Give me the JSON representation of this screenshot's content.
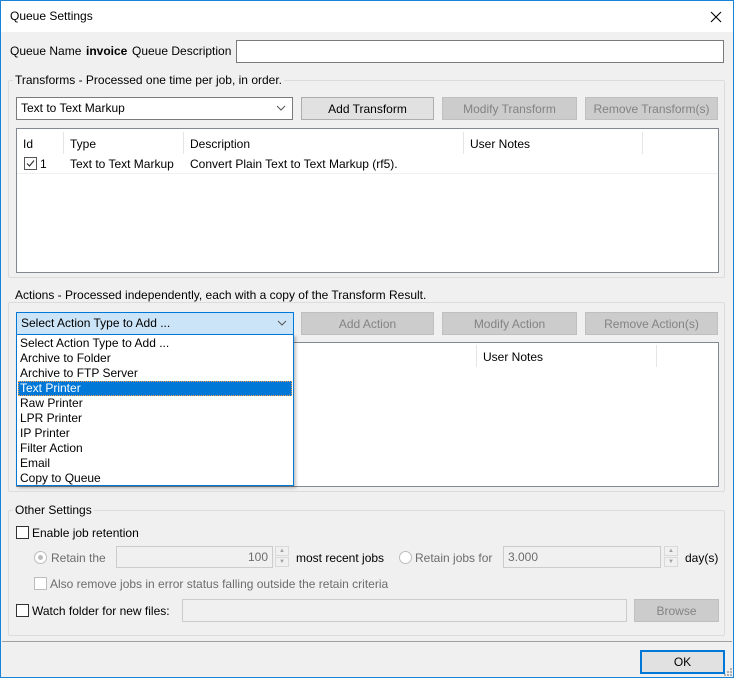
{
  "window": {
    "title": "Queue Settings",
    "close_icon": "close-icon"
  },
  "queue": {
    "name_label": "Queue Name",
    "name_value": "invoice",
    "description_label": "Queue Description",
    "description_value": ""
  },
  "transforms": {
    "group_title": "Transforms - Processed one time per job, in order.",
    "combo_value": "Text to Text Markup",
    "add_label": "Add Transform",
    "modify_label": "Modify Transform",
    "remove_label": "Remove Transform(s)",
    "columns": [
      "Id",
      "Type",
      "Description",
      "User Notes"
    ],
    "rows": [
      {
        "checked": true,
        "id": "1",
        "type": "Text to Text Markup",
        "description": "Convert Plain Text to Text Markup (rf5).",
        "notes": ""
      }
    ]
  },
  "actions": {
    "group_title": "Actions - Processed independently, each with a copy of the Transform Result.",
    "combo_value": "Select Action Type to Add ...",
    "add_label": "Add Action",
    "modify_label": "Modify Action",
    "remove_label": "Remove Action(s)",
    "columns": [
      "User Notes"
    ],
    "dropdown_options": [
      "Select Action Type to Add ...",
      "Archive to Folder",
      "Archive to FTP Server",
      "Text Printer",
      "Raw Printer",
      "LPR Printer",
      "IP Printer",
      "Filter Action",
      "Email",
      "Copy to Queue"
    ],
    "dropdown_highlighted": "Text Printer"
  },
  "other": {
    "group_title": "Other Settings",
    "enable_retention_label": "Enable job retention",
    "enable_retention_checked": false,
    "retain_the_label": "Retain the",
    "retain_count_value": "100",
    "most_recent_label": "most recent jobs",
    "retain_jobs_for_label": "Retain jobs for",
    "retain_days_value": "3.000",
    "days_label": "day(s)",
    "also_remove_label": "Also remove jobs in error status falling outside the retain criteria",
    "watch_folder_label": "Watch folder for new files:",
    "watch_folder_value": "",
    "browse_label": "Browse"
  },
  "footer": {
    "ok_label": "OK"
  }
}
